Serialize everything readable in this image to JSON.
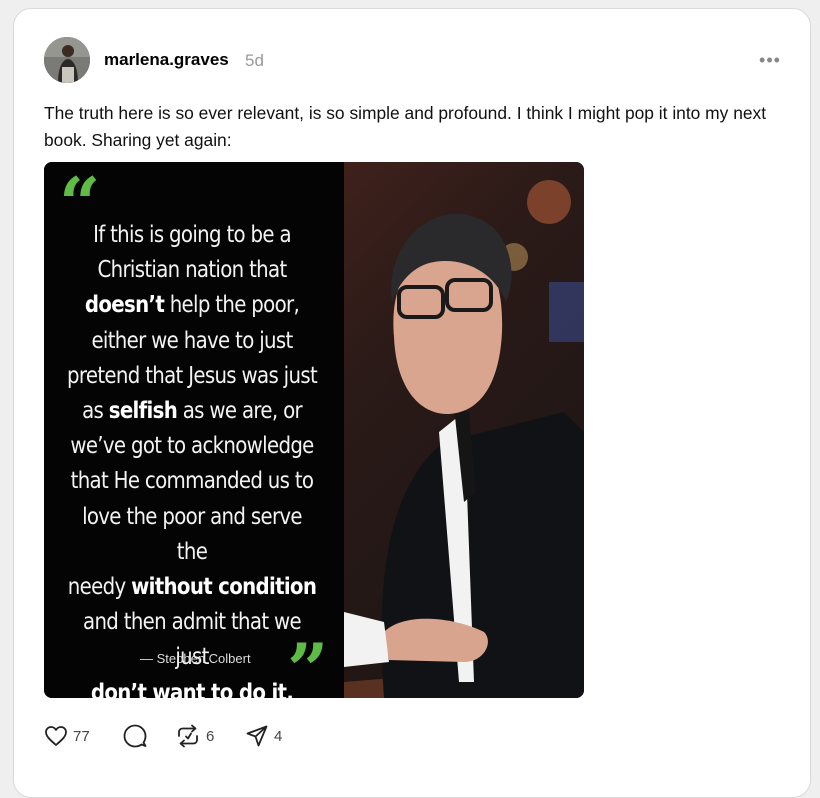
{
  "post": {
    "username": "marlena.graves",
    "time_ago": "5d",
    "more_label": "•••",
    "text": "The truth here is so ever relevant, is so simple and profound. I think I might pop it into my next book. Sharing yet again:"
  },
  "image": {
    "open_quote": "“",
    "close_quote": "”",
    "quote_lines": [
      [
        {
          "t": "If this is going to be a",
          "b": false
        }
      ],
      [
        {
          "t": "Christian nation that",
          "b": false
        }
      ],
      [
        {
          "t": "doesn’t",
          "b": true
        },
        {
          "t": " help the poor,",
          "b": false
        }
      ],
      [
        {
          "t": "either we have to just",
          "b": false
        }
      ],
      [
        {
          "t": "pretend that Jesus was just",
          "b": false
        }
      ],
      [
        {
          "t": "as ",
          "b": false
        },
        {
          "t": "selfish",
          "b": true
        },
        {
          "t": " as we are, or",
          "b": false
        }
      ],
      [
        {
          "t": "we’ve got to acknowledge",
          "b": false
        }
      ],
      [
        {
          "t": "that He commanded us to",
          "b": false
        }
      ],
      [
        {
          "t": "love the poor and serve the",
          "b": false
        }
      ],
      [
        {
          "t": "needy ",
          "b": false
        },
        {
          "t": "without condition",
          "b": true
        }
      ],
      [
        {
          "t": "and then admit that we just",
          "b": false
        }
      ],
      [
        {
          "t": "don’t want to do it.",
          "b": true
        }
      ]
    ],
    "attribution": "— Stephen Colbert"
  },
  "actions": {
    "like_count": "77",
    "repost_count": "6",
    "share_count": "4"
  },
  "colors": {
    "quote_green": "#5dbb46",
    "username": "#000000",
    "timestamp": "#999999"
  },
  "icons": [
    "avatar",
    "more-icon",
    "heart-icon",
    "comment-icon",
    "repost-icon",
    "share-icon"
  ]
}
